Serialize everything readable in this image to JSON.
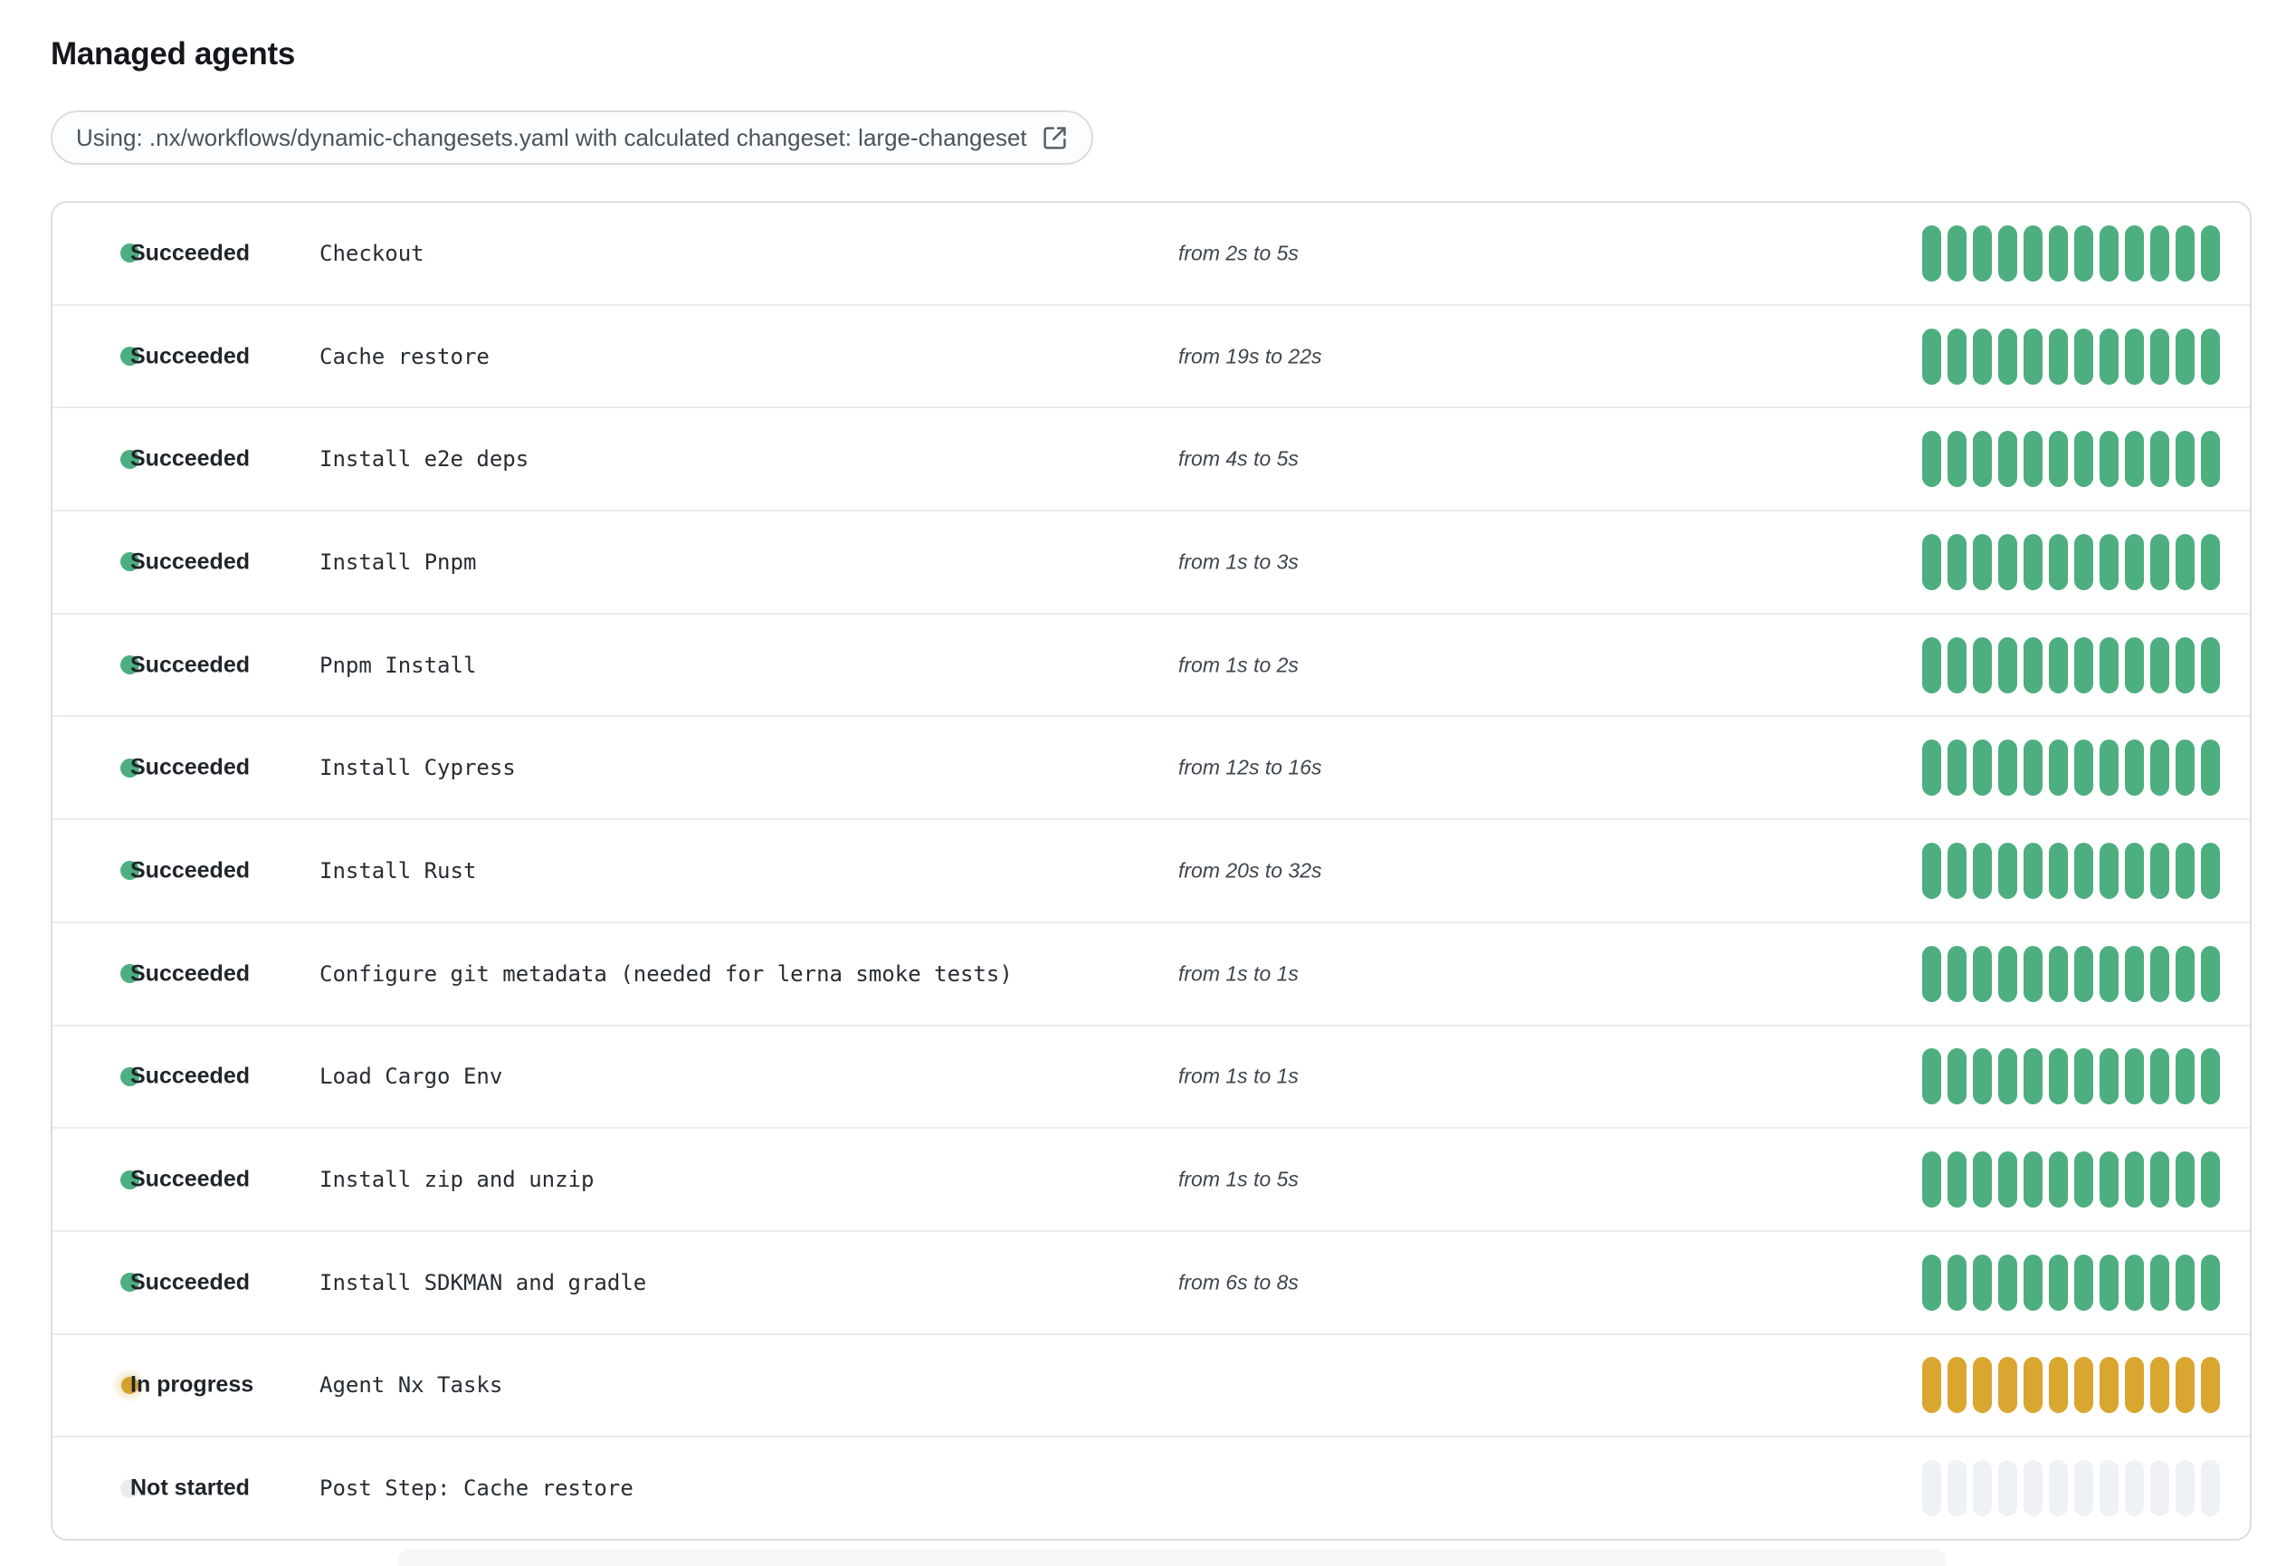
{
  "page": {
    "title": "Managed agents"
  },
  "workflow_banner": {
    "text": "Using: .nx/workflows/dynamic-changesets.yaml with calculated changeset: large-changeset",
    "icon": "external-link-icon"
  },
  "colors": {
    "succeeded": "#4dae80",
    "in_progress_segment": "#d9a630",
    "in_progress_dot": "#d4a12c",
    "not_started_segment": "#eef1f5",
    "not_started_dot": "#e8ecf0"
  },
  "agents": {
    "segments_per_bar": 12,
    "rows": [
      {
        "status": "Succeeded",
        "status_key": "succeeded",
        "step": "Checkout",
        "duration": "from 2s to 5s"
      },
      {
        "status": "Succeeded",
        "status_key": "succeeded",
        "step": "Cache restore",
        "duration": "from 19s to 22s"
      },
      {
        "status": "Succeeded",
        "status_key": "succeeded",
        "step": "Install e2e deps",
        "duration": "from 4s to 5s"
      },
      {
        "status": "Succeeded",
        "status_key": "succeeded",
        "step": "Install Pnpm",
        "duration": "from 1s to 3s"
      },
      {
        "status": "Succeeded",
        "status_key": "succeeded",
        "step": "Pnpm Install",
        "duration": "from 1s to 2s"
      },
      {
        "status": "Succeeded",
        "status_key": "succeeded",
        "step": "Install Cypress",
        "duration": "from 12s to 16s"
      },
      {
        "status": "Succeeded",
        "status_key": "succeeded",
        "step": "Install Rust",
        "duration": "from 20s to 32s"
      },
      {
        "status": "Succeeded",
        "status_key": "succeeded",
        "step": "Configure git metadata (needed for lerna smoke tests)",
        "duration": "from 1s to 1s"
      },
      {
        "status": "Succeeded",
        "status_key": "succeeded",
        "step": "Load Cargo Env",
        "duration": "from 1s to 1s"
      },
      {
        "status": "Succeeded",
        "status_key": "succeeded",
        "step": "Install zip and unzip",
        "duration": "from 1s to 5s"
      },
      {
        "status": "Succeeded",
        "status_key": "succeeded",
        "step": "Install SDKMAN and gradle",
        "duration": "from 6s to 8s"
      },
      {
        "status": "In progress",
        "status_key": "in-progress",
        "step": "Agent Nx Tasks",
        "duration": ""
      },
      {
        "status": "Not started",
        "status_key": "not-started",
        "step": "Post Step: Cache restore",
        "duration": ""
      }
    ]
  }
}
